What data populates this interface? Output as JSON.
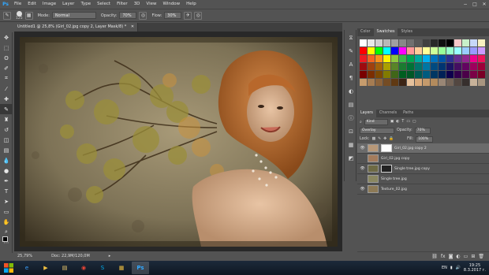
{
  "menubar": {
    "logo": "Ps",
    "items": [
      "File",
      "Edit",
      "Image",
      "Layer",
      "Type",
      "Select",
      "Filter",
      "3D",
      "View",
      "Window",
      "Help"
    ],
    "window_controls": [
      "−",
      "□",
      "✕"
    ]
  },
  "options": {
    "brush_size": "125",
    "mode_label": "Mode:",
    "mode_value": "Normal",
    "opacity_label": "Opacity:",
    "opacity_value": "70%",
    "flow_label": "Flow:",
    "flow_value": "30%"
  },
  "document": {
    "tab_title": "Untitled1 @ 25,8% (Girl_02.jpg copy 2, Layer Mask/8) *"
  },
  "status": {
    "zoom": "25,79%",
    "doc_size": "Doc: 22,9M/120,0M"
  },
  "swatches_panel": {
    "tabs": [
      "Color",
      "Swatches",
      "Styles"
    ],
    "active_tab": "Swatches",
    "colors": [
      "#ffffff",
      "#e8e8e8",
      "#d0d0d0",
      "#b8b8b8",
      "#a0a0a0",
      "#888888",
      "#707070",
      "#585858",
      "#404040",
      "#282828",
      "#101010",
      "#000000",
      "#f8c8c8",
      "#c8f0c8",
      "#c8d8f8",
      "#f8f0c0",
      "#ff0000",
      "#ffff00",
      "#00ff00",
      "#00ffff",
      "#0000ff",
      "#ff00ff",
      "#ff9999",
      "#ffcc99",
      "#ffff99",
      "#ccff99",
      "#99ff99",
      "#99ffcc",
      "#99ffff",
      "#99ccff",
      "#9999ff",
      "#cc99ff",
      "#ee1c24",
      "#f26522",
      "#f7941d",
      "#fff200",
      "#8dc63f",
      "#39b54a",
      "#00a651",
      "#00a99d",
      "#00aeef",
      "#0072bc",
      "#0054a6",
      "#2e3192",
      "#662d91",
      "#92278f",
      "#ec008c",
      "#ed145b",
      "#9e0b0f",
      "#a0410d",
      "#a36209",
      "#aba000",
      "#598527",
      "#1a7b30",
      "#007236",
      "#00746b",
      "#0076a3",
      "#004a80",
      "#003471",
      "#1b1464",
      "#440e62",
      "#630460",
      "#9e005d",
      "#9e0039",
      "#790000",
      "#7b2e00",
      "#7d4900",
      "#827b00",
      "#406618",
      "#005e20",
      "#005826",
      "#005952",
      "#005b7f",
      "#003663",
      "#002157",
      "#0d004c",
      "#32004b",
      "#4b0049",
      "#7b0046",
      "#7a0026",
      "#c69c6d",
      "#a67c52",
      "#8c6239",
      "#754c24",
      "#603913",
      "#3c2415",
      "#e6c19c",
      "#d9a97a",
      "#c49a6c",
      "#b38b5d",
      "#998675",
      "#736357",
      "#534741",
      "#362f2d",
      "#c7b299",
      "#a89680"
    ]
  },
  "layers_panel": {
    "tabs": [
      "Layers",
      "Channels",
      "Paths"
    ],
    "active_tab": "Layers",
    "filter_label": "Kind",
    "blend_mode": "Overlay",
    "opacity_label": "Opacity:",
    "opacity_value": "70%",
    "lock_label": "Lock:",
    "fill_label": "Fill:",
    "fill_value": "100%",
    "layers": [
      {
        "name": "Girl_02.jpg copy 2",
        "visible": true,
        "selected": true,
        "has_mask": true,
        "thumb_color": "#b89878"
      },
      {
        "name": "Girl_02.jpg copy",
        "visible": false,
        "selected": false,
        "has_mask": false,
        "thumb_color": "#a47c5c"
      },
      {
        "name": "Single tree.jpg copy",
        "visible": true,
        "selected": false,
        "has_mask": true,
        "thumb_color": "#6e6a44"
      },
      {
        "name": "Single tree.jpg",
        "visible": false,
        "selected": false,
        "has_mask": false,
        "thumb_color": "#8a8760"
      },
      {
        "name": "Texture_02.jpg",
        "visible": true,
        "selected": false,
        "has_mask": false,
        "thumb_color": "#8d7a56"
      }
    ]
  },
  "taskbar": {
    "apps": [
      "e",
      "▶",
      "▤",
      "◉",
      "S",
      "▦",
      "Ps"
    ],
    "active_app": "Ps",
    "language": "EN",
    "time": "19:25",
    "date": "8.3.2017 г."
  }
}
